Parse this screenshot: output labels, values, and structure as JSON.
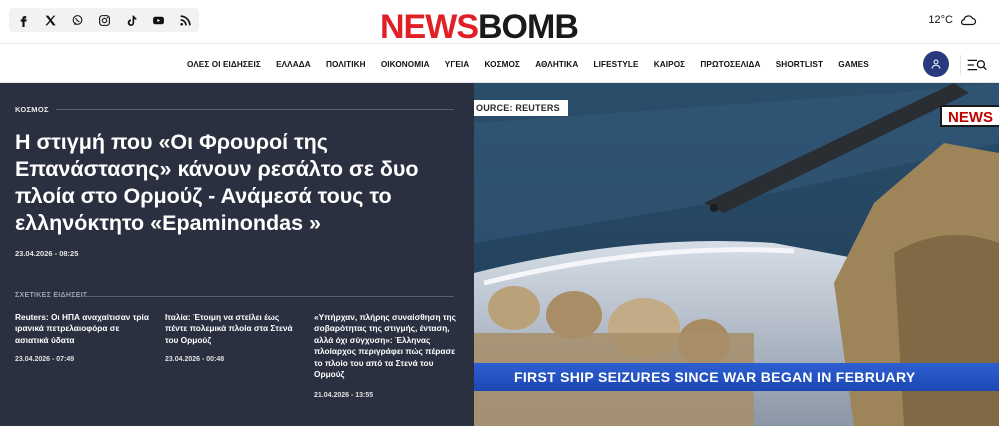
{
  "header": {
    "social_icons": [
      "facebook-icon",
      "x-icon",
      "viber-icon",
      "instagram-icon",
      "tiktok-icon",
      "youtube-icon",
      "rss-icon"
    ],
    "logo_part1": "NEWS",
    "logo_part2": "BOMB",
    "weather": {
      "temp": "12°C",
      "icon": "cloud-icon"
    }
  },
  "nav": {
    "items": [
      "ΟΛΕΣ ΟΙ ΕΙΔΗΣΕΙΣ",
      "ΕΛΛΑΔΑ",
      "ΠΟΛΙΤΙΚΗ",
      "ΟΙΚΟΝΟΜΙΑ",
      "ΥΓΕΙΑ",
      "ΚΟΣΜΟΣ",
      "ΑΘΛΗΤΙΚΑ",
      "LIFESTYLE",
      "ΚΑΙΡΟΣ",
      "ΠΡΩΤΟΣΕΛΙΔΑ",
      "SHORTLIST",
      "GAMES"
    ],
    "user_icon": "user-icon",
    "menu_icon": "search-menu-icon"
  },
  "hero": {
    "section": "ΚΟΣΜΟΣ",
    "headline": "Η στιγμή που «Οι Φρουροί της Επανάστασης» κάνουν ρεσάλτο σε δυο πλοία στο Ορμούζ - Ανάμεσά τους το ελληνόκτητο «Epaminondas »",
    "date": "23.04.2026 - 08:25",
    "related_label": "ΣΧΕΤΙΚΕΣ ΕΙΔΗΣΕΙΣ",
    "related": [
      {
        "title": "Reuters: Οι ΗΠΑ αναχαίτισαν τρία ιρανικά πετρελαιοφόρα σε ασιατικά ύδατα",
        "date": "23.04.2026 - 07:49"
      },
      {
        "title": "Ιταλία: Έτοιμη να στείλει έως πέντε πολεμικά πλοία στα Στενά του Ορμούζ",
        "date": "23.04.2026 - 00:48"
      },
      {
        "title": "«Υπήρχαν, πλήρης συναίσθηση της σοβαρότητας της στιγμής, ένταση, αλλά όχι σύγχυση»: Έλληνας πλοίαρχος περιγράφει πώς πέρασε το πλοίο του από τα Στενά του Ορμούζ",
        "date": "21.04.2026 - 13:55"
      }
    ],
    "image": {
      "source_tag": "OURCE: REUTERS",
      "badge": "NEWS",
      "ticker": "FIRST SHIP SEIZURES SINCE WAR BEGAN IN FEBRUARY"
    }
  },
  "colors": {
    "logo_red": "#e01f26",
    "hero_panel": "#2b3040",
    "user_button": "#283a7d",
    "ticker_blue": "#2d5fd1"
  }
}
